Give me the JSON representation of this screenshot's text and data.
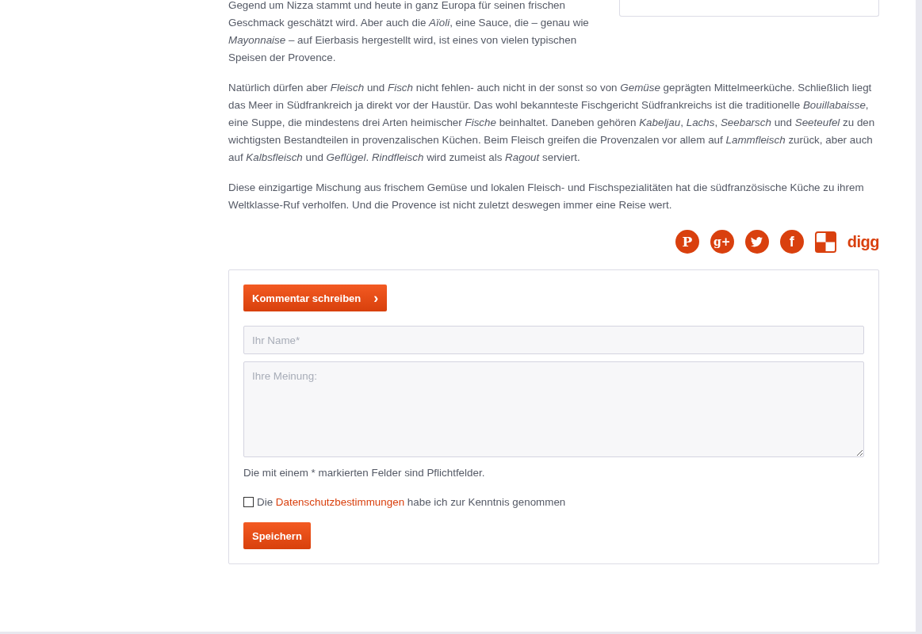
{
  "intro": "Gegend um Nizza stammt und heute in ganz Europa für seinen frischen Geschmack geschätzt wird. Aber auch die *Aïoli*, eine Sauce, die – genau wie *Mayonnaise* – auf Eierbasis hergestellt wird, ist eines von vielen typischen Speisen der Provence.",
  "paragraphs": [
    "Natürlich dürfen aber *Fleisch* und *Fisch* nicht fehlen- auch nicht in der sonst so von *Gemüse* geprägten Mittelmeerküche. Schließlich liegt das Meer in Südfrankreich ja direkt vor der Haustür. Das wohl bekannteste Fischgericht Südfrankreichs ist die traditionelle *Bouillabaisse*, eine Suppe, die mindestens drei Arten heimischer *Fische* beinhaltet. Daneben gehören *Kabeljau*, *Lachs*, *Seebarsch* und *Seeteufel* zu den wichtigsten Bestandteilen in provenzalischen Küchen. Beim Fleisch greifen die Provenzalen vor allem auf *Lammfleisch* zurück, aber auch auf *Kalbsfleisch* und *Geflügel*. *Rindfleisch* wird zumeist als *Ragout* serviert.",
    "Diese einzigartige Mischung aus frischem Gemüse und lokalen Fleisch- und Fischspezialitäten hat die südfranzösische Küche zu ihrem Weltklasse-Ruf verholfen. Und die Provence ist nicht zuletzt deswegen immer eine Reise wert."
  ],
  "social": [
    {
      "kind": "pinterest",
      "label": "P"
    },
    {
      "kind": "gplus",
      "label": "g+"
    },
    {
      "kind": "twitter"
    },
    {
      "kind": "facebook",
      "label": "f"
    },
    {
      "kind": "delicious"
    },
    {
      "kind": "digg",
      "label": "digg"
    }
  ],
  "comment": {
    "write_button": "Kommentar schreiben",
    "write_caret": "›",
    "name_placeholder": "Ihr Name*",
    "opinion_placeholder": "Ihre Meinung:",
    "required_note": "Die mit einem * markierten Felder sind Pflichtfelder.",
    "privacy": {
      "checked": false,
      "before": "Die",
      "link": "Datenschutzbestimmungen",
      "after": "habe ich zur Kenntnis genommen"
    },
    "save_button": "Speichern"
  }
}
